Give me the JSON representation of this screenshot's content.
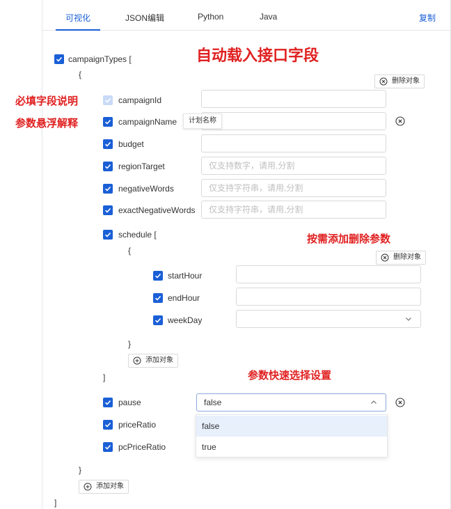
{
  "tabs": [
    {
      "label": "可视化"
    },
    {
      "label": "JSON编辑"
    },
    {
      "label": "Python"
    },
    {
      "label": "Java"
    }
  ],
  "copy_label": "复制",
  "annotations": {
    "auto_load": "自动载入接口字段",
    "required_desc": "必填字段说明",
    "hover_explain": "参数悬浮解释",
    "add_remove": "按需添加删除参数",
    "quick_select": "参数快速选择设置"
  },
  "tree": {
    "root_label": "campaignTypes [",
    "open_brace": "{",
    "close_brace": "}",
    "close_bracket": "]",
    "delete_object": "删除对象",
    "add_object": "添加对象",
    "fields": {
      "campaignId": {
        "label": "campaignId",
        "value": "",
        "placeholder": ""
      },
      "campaignName": {
        "label": "campaignName",
        "value": "",
        "placeholder": "",
        "tooltip": "计划名称"
      },
      "budget": {
        "label": "budget",
        "value": "",
        "placeholder": ""
      },
      "regionTarget": {
        "label": "regionTarget",
        "value": "",
        "placeholder": "仅支持数字，请用,分割"
      },
      "negativeWords": {
        "label": "negativeWords",
        "value": "",
        "placeholder": "仅支持字符串，请用,分割"
      },
      "exactNegativeWords": {
        "label": "exactNegativeWords",
        "value": "",
        "placeholder": "仅支持字符串，请用,分割"
      }
    },
    "schedule": {
      "label": "schedule [",
      "fields": {
        "startHour": {
          "label": "startHour",
          "value": ""
        },
        "endHour": {
          "label": "endHour",
          "value": ""
        },
        "weekDay": {
          "label": "weekDay",
          "value": ""
        }
      }
    },
    "pause": {
      "label": "pause",
      "value": "false",
      "options": [
        "false",
        "true"
      ]
    },
    "priceRatio": {
      "label": "priceRatio"
    },
    "pcPriceRatio": {
      "label": "pcPriceRatio"
    }
  },
  "colors": {
    "accent": "#1a5fd6",
    "annotation": "#e02020",
    "border": "#d9d9d9",
    "option_selected_bg": "#e8f0fc"
  }
}
